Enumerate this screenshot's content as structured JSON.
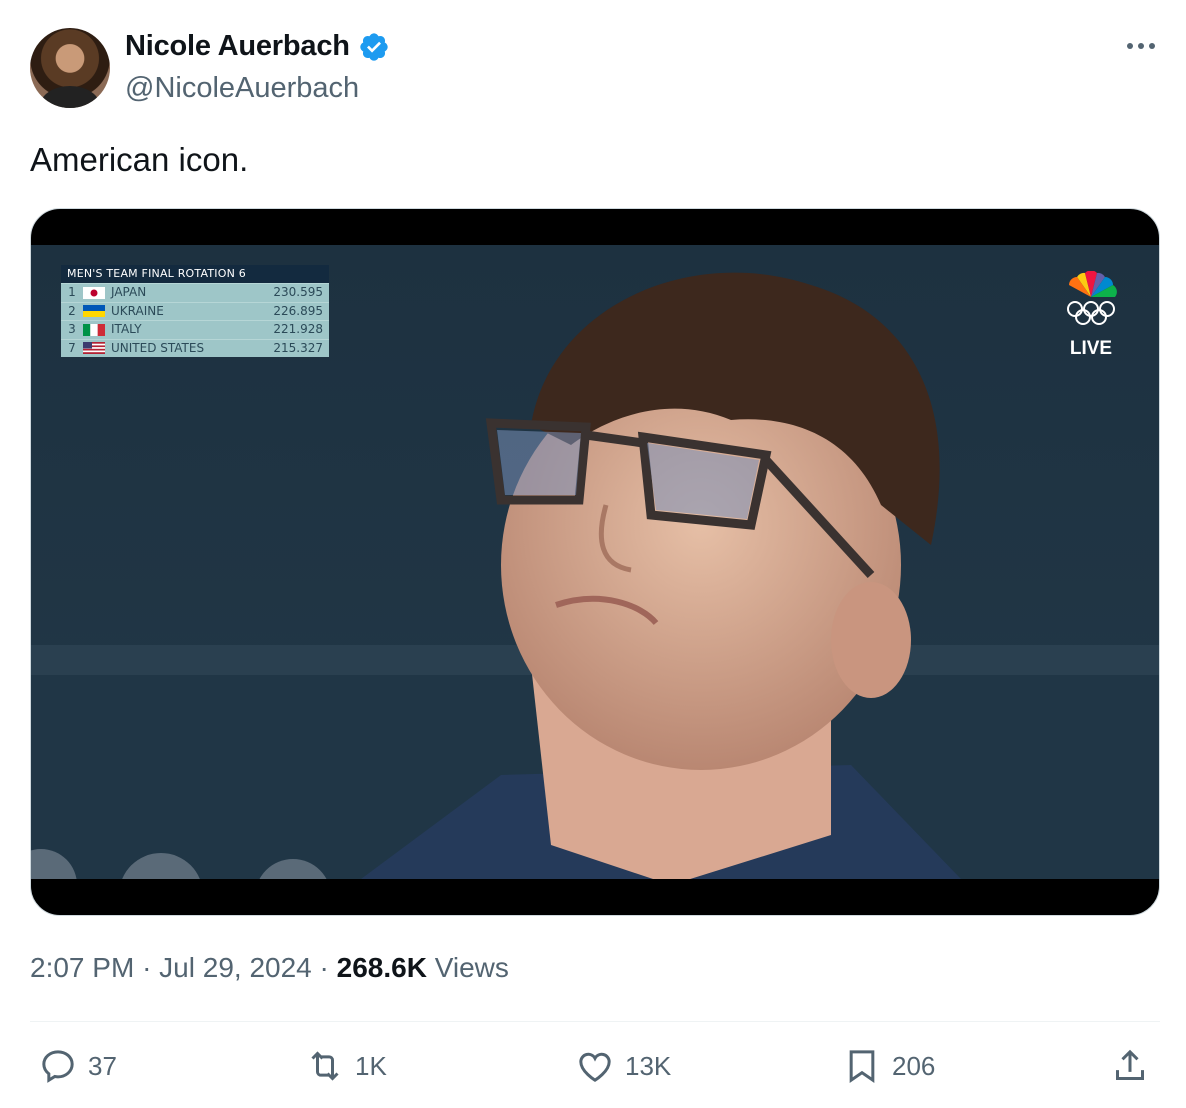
{
  "author": {
    "name": "Nicole Auerbach",
    "handle": "@NicoleAuerbach"
  },
  "tweet": {
    "text": "American icon."
  },
  "media": {
    "scoreboard": {
      "title": "MEN'S TEAM FINAL  ROTATION 6",
      "rows": [
        {
          "rank": "1",
          "team": "JAPAN",
          "score": "230.595",
          "flag": "japan"
        },
        {
          "rank": "2",
          "team": "UKRAINE",
          "score": "226.895",
          "flag": "ukraine"
        },
        {
          "rank": "3",
          "team": "ITALY",
          "score": "221.928",
          "flag": "italy"
        },
        {
          "rank": "7",
          "team": "UNITED STATES",
          "score": "215.327",
          "flag": "usa"
        }
      ]
    },
    "live_label": "LIVE"
  },
  "meta": {
    "time": "2:07 PM",
    "date": "Jul 29, 2024",
    "views_count": "268.6K",
    "views_label": "Views"
  },
  "actions": {
    "replies": "37",
    "reposts": "1K",
    "likes": "13K",
    "bookmarks": "206"
  },
  "colors": {
    "text": "#0f1419",
    "secondary": "#536471",
    "verified": "#1d9bf0"
  }
}
